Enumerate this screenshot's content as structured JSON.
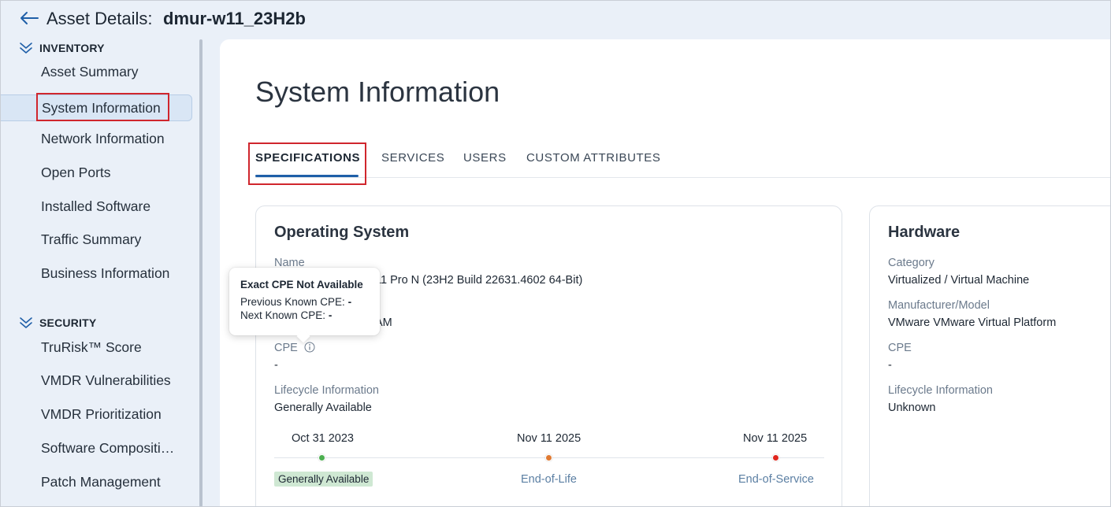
{
  "header": {
    "title_label": "Asset Details:",
    "asset_name": "dmur-w11_23H2b"
  },
  "sidebar": {
    "inventory": {
      "heading": "INVENTORY",
      "items": [
        {
          "label": "Asset Summary"
        },
        {
          "label": "System Information"
        },
        {
          "label": "Network Information"
        },
        {
          "label": "Open Ports"
        },
        {
          "label": "Installed Software"
        },
        {
          "label": "Traffic Summary"
        },
        {
          "label": "Business Information"
        }
      ]
    },
    "security": {
      "heading": "SECURITY",
      "items": [
        {
          "label": "TruRisk™ Score"
        },
        {
          "label": "VMDR Vulnerabilities"
        },
        {
          "label": "VMDR Prioritization"
        },
        {
          "label": "Software Compositi…"
        },
        {
          "label": "Patch Management"
        }
      ]
    },
    "active_item": "System Information"
  },
  "main": {
    "page_title": "System Information",
    "tabs": [
      {
        "label": "SPECIFICATIONS",
        "active": true
      },
      {
        "label": "SERVICES"
      },
      {
        "label": "USERS"
      },
      {
        "label": "CUSTOM ATTRIBUTES"
      }
    ],
    "os_card": {
      "title": "Operating System",
      "name_label": "Name",
      "name_value": "11 Pro N (23H2 Build 22631.4602 64-Bit)",
      "hidden_value": "AM",
      "cpe_label": "CPE",
      "cpe_value": "-",
      "lifecycle_label": "Lifecycle Information",
      "lifecycle_value": "Generally Available",
      "timeline": [
        {
          "date": "Oct 31 2023",
          "label": "Generally Available",
          "color": "#4caf50"
        },
        {
          "date": "Nov 11 2025",
          "label": "End-of-Life",
          "color": "#e07a32"
        },
        {
          "date": "Nov 11 2025",
          "label": "End-of-Service",
          "color": "#e0261e"
        }
      ]
    },
    "hardware_card": {
      "title": "Hardware",
      "category_label": "Category",
      "category_value": "Virtualized / Virtual Machine",
      "manufacturer_label": "Manufacturer/Model",
      "manufacturer_value": "VMware VMware Virtual Platform",
      "cpe_label": "CPE",
      "cpe_value": "-",
      "lifecycle_label": "Lifecycle Information",
      "lifecycle_value": "Unknown"
    },
    "tooltip": {
      "title": "Exact CPE Not Available",
      "previous_label": "Previous Known CPE:",
      "previous_value": "-",
      "next_label": "Next Known CPE:",
      "next_value": "-"
    }
  },
  "colors": {
    "accent": "#1f5fa8",
    "highlight": "#d0262d",
    "page_bg": "#eaf0f8"
  }
}
